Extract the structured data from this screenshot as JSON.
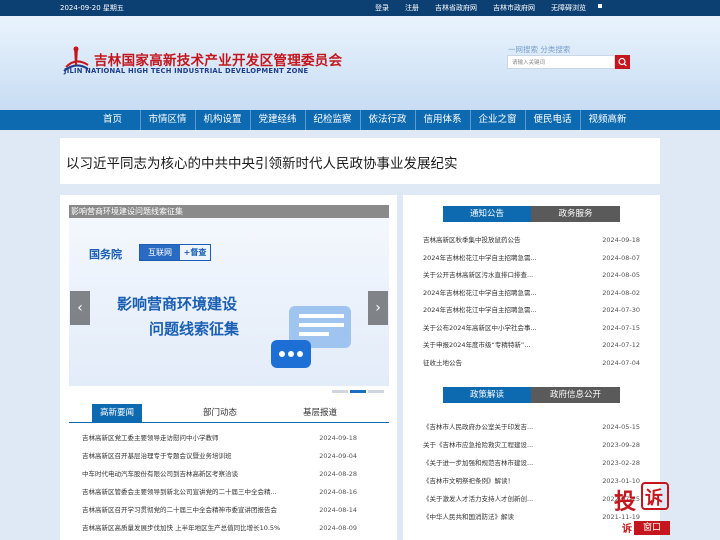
{
  "topbar": {
    "date": "2024-09-20 星期五",
    "links": [
      "登录",
      "注册",
      "吉林省政府网",
      "吉林市政府网",
      "无障碍浏览"
    ]
  },
  "header": {
    "title_cn": "吉林国家高新技术产业开发区管理委员会",
    "title_en": "JILIN NATIONAL HIGH TECH INDUSTRIAL DEVELOPMENT ZONE",
    "search_tabs": "一网搜索  分类搜索",
    "search_placeholder": "请输入关键词"
  },
  "nav": [
    "首页",
    "市情区情",
    "机构设置",
    "党建经纬",
    "纪检监察",
    "依法行政",
    "信用体系",
    "企业之窗",
    "便民电话",
    "视频高新"
  ],
  "headline": "以习近平同志为核心的中共中央引领新时代人民政协事业发展纪实",
  "slider": {
    "caption": "影响营商环境建设问题线索征集",
    "badge_left": "国务院",
    "badge_mid": "互联网",
    "badge_right": "+督查",
    "line1": "影响营商环境建设",
    "line2": "问题线索征集",
    "prev": "‹",
    "next": "›"
  },
  "news_tabs": [
    "高新要闻",
    "部门动态",
    "基层报道"
  ],
  "news": [
    {
      "title": "吉林高新区党工委主要领导走访慰问中小学教师",
      "date": "2024-09-18"
    },
    {
      "title": "吉林高新区召开基层治理专于专题会议暨业务培训班",
      "date": "2024-09-04"
    },
    {
      "title": "中车时代电动汽车股份有限公司到吉林高新区考察洽谈",
      "date": "2024-08-28"
    },
    {
      "title": "吉林高新区管委会主要领导到新北公司宣讲党的二十届三中全会精...",
      "date": "2024-08-16"
    },
    {
      "title": "吉林高新区召开学习贯彻党的二十届三中全会精神市委宣讲团报告会",
      "date": "2024-08-14"
    },
    {
      "title": "吉林高新区高质量发展步伐加快 上半年地区生产总值同比增长10.5%",
      "date": "2024-08-09"
    }
  ],
  "notice_tabs": [
    "通知公告",
    "政务服务"
  ],
  "notices": [
    {
      "title": "吉林高新区秋季集中投放鼠药公告",
      "date": "2024-09-18"
    },
    {
      "title": "2024年吉林松花江中学自主招聘急需...",
      "date": "2024-08-07"
    },
    {
      "title": "关于公开吉林高新区污水直排口排查...",
      "date": "2024-08-05"
    },
    {
      "title": "2024年吉林松花江中学自主招聘急需...",
      "date": "2024-08-02"
    },
    {
      "title": "2024年吉林松花江中学自主招聘急需...",
      "date": "2024-07-30"
    },
    {
      "title": "关于公布2024年高新区中小学社会事...",
      "date": "2024-07-15"
    },
    {
      "title": "关于申报2024年度市级“专精特新”...",
      "date": "2024-07-12"
    },
    {
      "title": "征收土地公告",
      "date": "2024-07-04"
    }
  ],
  "policy_tabs": [
    "政策解读",
    "政府信息公开"
  ],
  "policies": [
    {
      "title": "《吉林市人民政府办公室关于印发吉...",
      "date": "2024-05-15"
    },
    {
      "title": "关于《吉林市应急抢险救灾工程建设...",
      "date": "2023-09-28"
    },
    {
      "title": "《关于进一步加强和规范吉林市建设...",
      "date": "2023-02-28"
    },
    {
      "title": "《吉林市文明祭祀条例》解读！",
      "date": "2023-01-10"
    },
    {
      "title": "《关于激发人才活力支持人才创新创...",
      "date": "2022-07-15"
    },
    {
      "title": "《中华人民共和国消防法》解读",
      "date": "2021-11-19"
    }
  ],
  "complain": {
    "big": "投",
    "big2": "诉",
    "sub": "窗口",
    "mark": "诉"
  },
  "colors": {
    "nav": "#0d6ab0",
    "red": "#c4161c",
    "topbar": "#0c3f72"
  }
}
